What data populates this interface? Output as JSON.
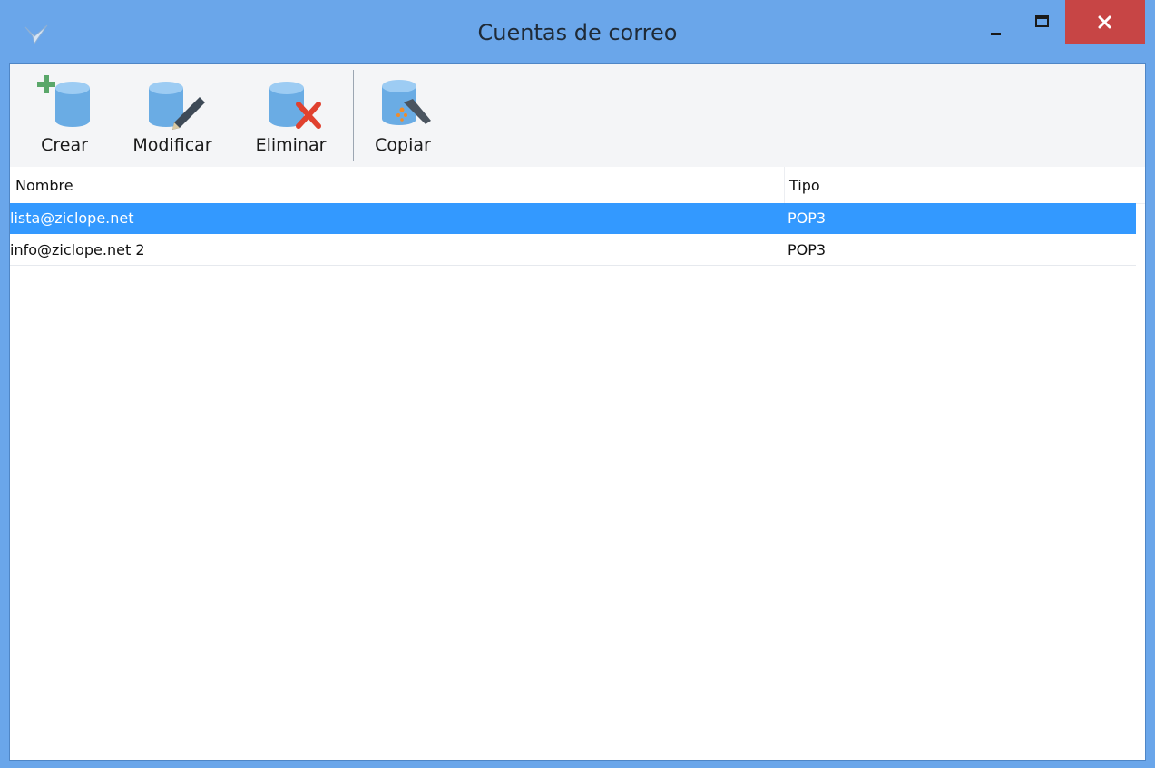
{
  "window": {
    "title": "Cuentas de correo",
    "accent": "#6aa6ea",
    "close_color": "#c74545"
  },
  "toolbar": {
    "buttons": [
      {
        "label": "Crear",
        "icon": "database-add-icon"
      },
      {
        "label": "Modificar",
        "icon": "database-edit-icon"
      },
      {
        "label": "Eliminar",
        "icon": "database-delete-icon"
      },
      {
        "label": "Copiar",
        "icon": "database-copy-icon"
      }
    ]
  },
  "table": {
    "columns": [
      "Nombre",
      "Tipo"
    ],
    "rows": [
      {
        "nombre": "lista@ziclope.net",
        "tipo": "POP3",
        "selected": true
      },
      {
        "nombre": "info@ziclope.net 2",
        "tipo": "POP3",
        "selected": false
      }
    ],
    "selection_color": "#3399ff"
  }
}
